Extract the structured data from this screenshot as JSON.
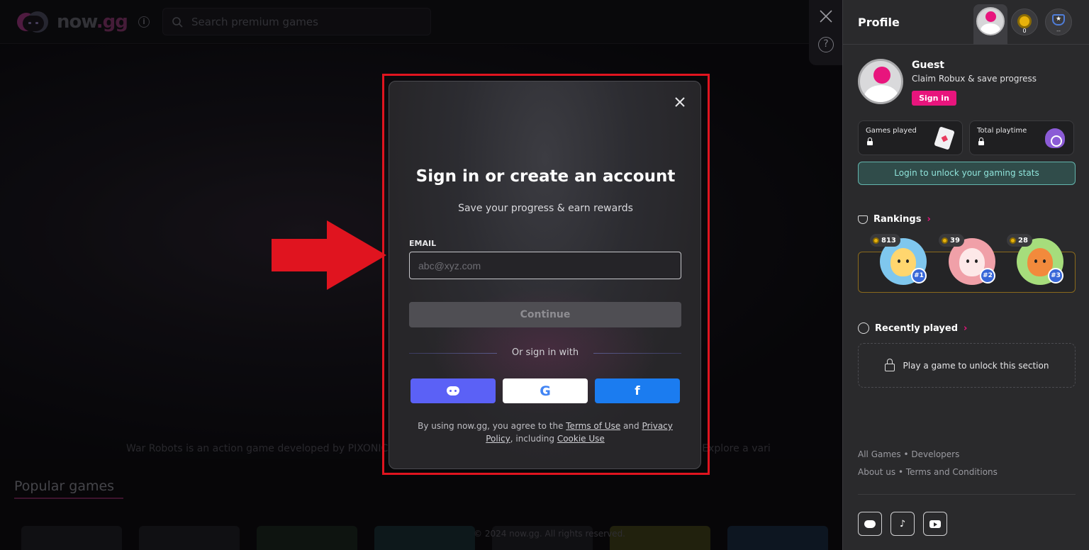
{
  "topbar": {
    "logo_text": "now",
    "logo_suffix": ".gg",
    "search_placeholder": "Search premium games"
  },
  "hero": {
    "description_left": "War Robots is an action game developed by PIXONIC",
    "description_right": "n your browser. Explore a vari"
  },
  "popular": {
    "title": "Popular games"
  },
  "footer_page": {
    "copyright": "© 2024 now.gg. All rights reserved."
  },
  "modal": {
    "title": "Sign in or create an account",
    "subtitle": "Save your progress & earn rewards",
    "email_label": "EMAIL",
    "email_placeholder": "abc@xyz.com",
    "email_value": "",
    "continue_label": "Continue",
    "or_label": "Or sign in with",
    "social_buttons": [
      {
        "name": "Discord",
        "icon": "discord-icon",
        "color": "#5b61f6"
      },
      {
        "name": "Google",
        "icon": "google-icon",
        "color": "#ffffff"
      },
      {
        "name": "Facebook",
        "icon": "facebook-icon",
        "color": "#1b7cf0"
      }
    ],
    "terms_prefix": "By using now.gg, you agree to the ",
    "terms_link": "Terms of Use",
    "terms_and": " and ",
    "privacy_link": "Privacy Policy",
    "terms_including": ", including ",
    "cookie_link": "Cookie Use"
  },
  "annotation": {
    "highlight_color": "#e0141f"
  },
  "profile": {
    "title": "Profile",
    "coin_count": "0",
    "trophy_label": "--",
    "guest_name": "Guest",
    "guest_sub": "Claim Robux & save progress",
    "signin_label": "Sign in",
    "accent_color": "#e8157d",
    "stats": [
      {
        "label": "Games played"
      },
      {
        "label": "Total playtime"
      }
    ],
    "unlock_label": "Login to unlock your gaming stats",
    "rankings_title": "Rankings",
    "rankings": [
      {
        "coins": "813",
        "rank": "#1"
      },
      {
        "coins": "39",
        "rank": "#2"
      },
      {
        "coins": "28",
        "rank": "#3"
      }
    ],
    "recent_title": "Recently played",
    "recent_empty": "Play a game to unlock this section",
    "links_row1": "All Games • Developers",
    "links_row2": "About us • Terms and Conditions",
    "socials": [
      "discord-icon",
      "tiktok-icon",
      "youtube-icon"
    ]
  }
}
